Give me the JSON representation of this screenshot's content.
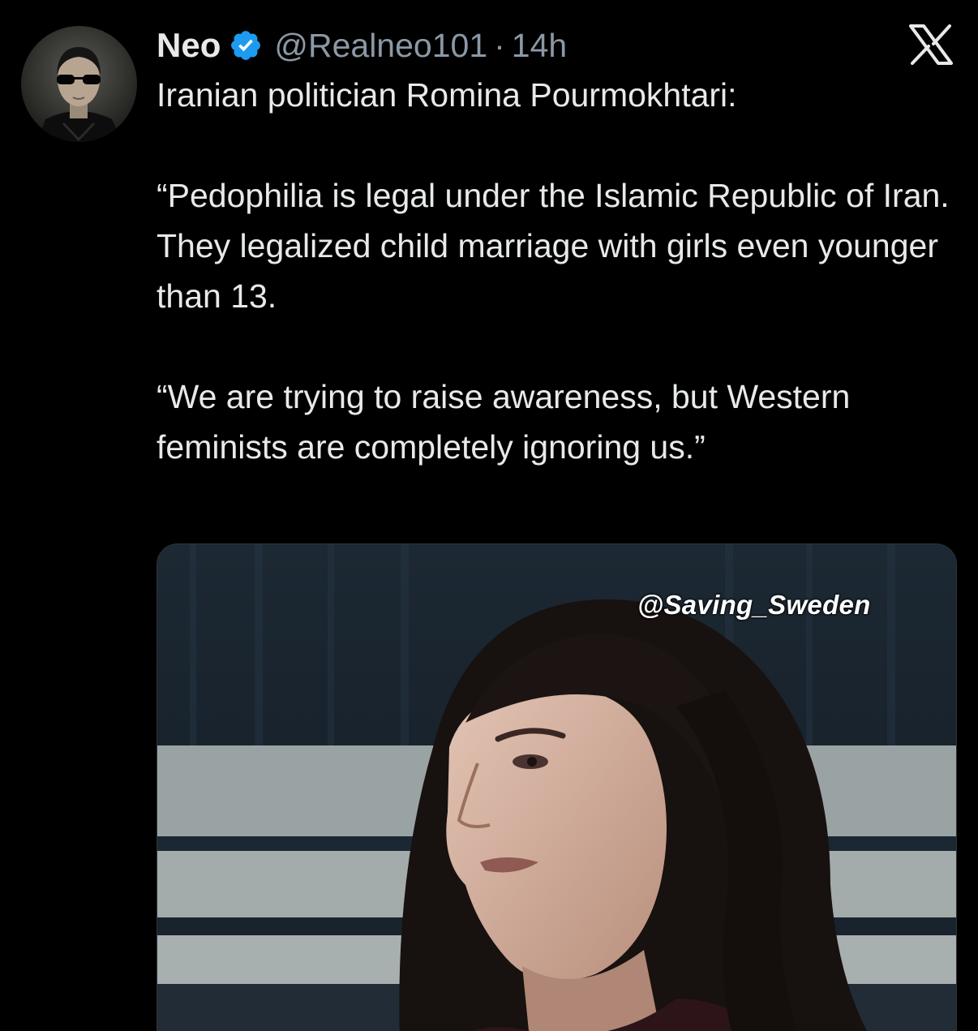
{
  "author": {
    "display_name": "Neo",
    "handle": "@Realneo101",
    "separator": "·",
    "time": "14h",
    "verified_icon": "verified-badge-icon",
    "verified_color": "#1d9bf0"
  },
  "brand": {
    "logo": "x-logo-icon",
    "logo_text": "𝕏"
  },
  "tweet": {
    "paragraphs": [
      "Iranian politician Romina Pourmokhtari:",
      "“Pedophilia is legal under the Islamic Republic of Iran. They legalized child marriage with girls even younger than 13.",
      "“We are trying to raise awareness, but Western feminists are completely ignoring us.”"
    ]
  },
  "media": {
    "type": "video-still",
    "watermark": "@Saving_Sweden"
  },
  "colors": {
    "background": "#000000",
    "text_primary": "#e7e9ea",
    "text_secondary": "#8b98a5",
    "accent": "#1d9bf0"
  }
}
